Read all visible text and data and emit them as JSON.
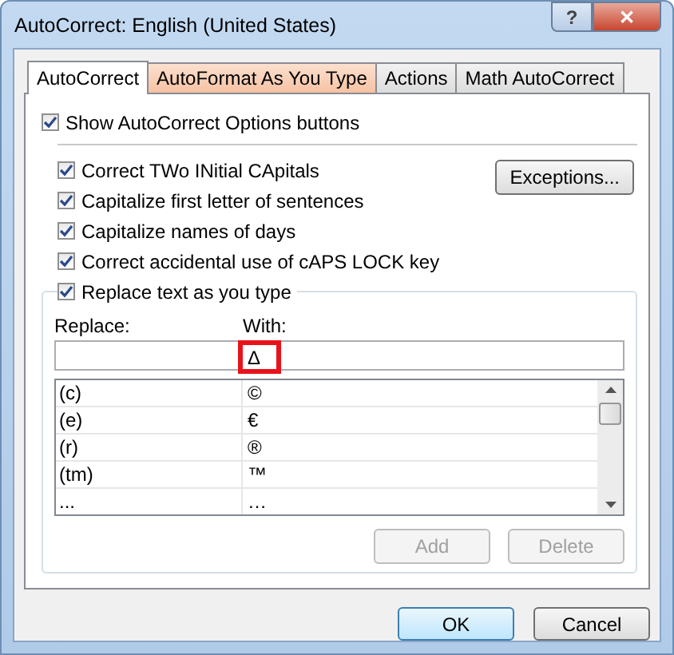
{
  "window": {
    "title": "AutoCorrect: English (United States)",
    "help": "?",
    "close": "✕"
  },
  "tabs": [
    {
      "label": "AutoCorrect",
      "selected": true,
      "hovered": false
    },
    {
      "label": "AutoFormat As You Type",
      "selected": false,
      "hovered": true
    },
    {
      "label": "Actions",
      "selected": false,
      "hovered": false
    },
    {
      "label": "Math AutoCorrect",
      "selected": false,
      "hovered": false
    }
  ],
  "show_options": {
    "label": "Show AutoCorrect Options buttons",
    "checked": true
  },
  "options": [
    {
      "label": "Correct TWo INitial CApitals",
      "checked": true
    },
    {
      "label": "Capitalize first letter of sentences",
      "checked": true
    },
    {
      "label": "Capitalize names of days",
      "checked": true
    },
    {
      "label": "Correct accidental use of cAPS LOCK key",
      "checked": true
    }
  ],
  "exceptions_button": "Exceptions...",
  "replace_text": {
    "label": "Replace text as you type",
    "checked": true
  },
  "replace_label": "Replace:",
  "with_label": "With:",
  "with_field": {
    "value": "Δ",
    "highlighted": true
  },
  "entries": [
    {
      "replace": "(c)",
      "with": "©"
    },
    {
      "replace": "(e)",
      "with": "€"
    },
    {
      "replace": "(r)",
      "with": "®"
    },
    {
      "replace": "(tm)",
      "with": "™"
    },
    {
      "replace": "...",
      "with": "…"
    }
  ],
  "add_button": {
    "label": "Add",
    "disabled": true
  },
  "delete_button": {
    "label": "Delete",
    "disabled": true
  },
  "ok_button": "OK",
  "cancel_button": "Cancel"
}
